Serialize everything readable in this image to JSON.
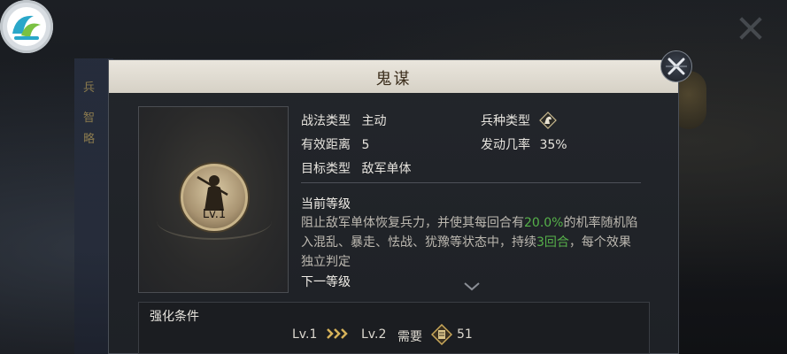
{
  "dialog": {
    "title": "鬼谋",
    "skill": {
      "level": "Lv.1"
    },
    "tactic_type": {
      "label": "战法类型",
      "value": "主动"
    },
    "unit_type": {
      "label": "兵种类型",
      "icon": "horse-icon"
    },
    "range": {
      "label": "有效距离",
      "value": "5"
    },
    "trigger_rate": {
      "label": "发动几率",
      "value": "35%"
    },
    "target_type": {
      "label": "目标类型",
      "value": "敌军单体"
    },
    "current_level": {
      "title": "当前等级",
      "desc_1": "阻止敌军单体恢复兵力，并使其每回合有",
      "desc_hl_1": "20.0%",
      "desc_2": "的机率随机陷入混乱、暴走、怯战、犹豫等状态中，持续",
      "desc_hl_2": "3回合",
      "desc_3": "，每个效果独立判定"
    },
    "next_level": {
      "title": "下一等级"
    },
    "enhance": {
      "title": "强化条件",
      "from_level": "Lv.1",
      "to_level": "Lv.2",
      "need_label": "需要",
      "cost": "51"
    }
  },
  "background": {
    "left_text_1": "兵",
    "left_text_2": "智",
    "left_text_3": "略"
  },
  "colors": {
    "highlight": "#56b14a",
    "title_text": "#3b2d1b",
    "panel": "#1e2126"
  }
}
